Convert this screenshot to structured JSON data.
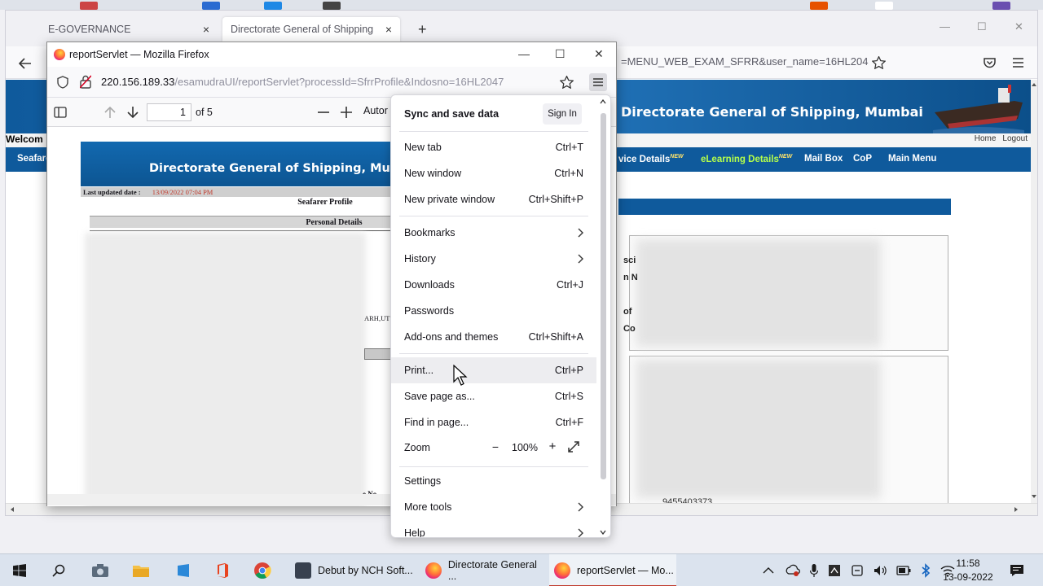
{
  "background_browser": {
    "tabs": [
      {
        "label": "E-GOVERNANCE",
        "close": "×"
      },
      {
        "label": "Directorate General of Shipping",
        "close": "×"
      }
    ],
    "new_tab": "+",
    "url_tail": "=MENU_WEB_EXAM_SFRR&user_name=16HL204",
    "header_title": "Directorate General of Shipping, Mumbai",
    "welcome": "Welcom",
    "home": "Home",
    "logout": "Logout",
    "menu": [
      {
        "label": "Seafare"
      },
      {
        "label": "vice Details",
        "new": "NEW"
      },
      {
        "label": "eLearning Details",
        "new": "NEW"
      },
      {
        "label": "Mail Box"
      },
      {
        "label": "CoP"
      },
      {
        "label": "Main Menu"
      }
    ],
    "partials": [
      "sci",
      "n N",
      "of",
      "Co"
    ],
    "phone": "9455403373"
  },
  "popup": {
    "title": "reportServlet — Mozilla Firefox",
    "url_host": "220.156.189.33",
    "url_path": "/esamudraUI/reportServlet?processId=SfrrProfile&Indosno=16HL2047",
    "pdf": {
      "page_number": "1",
      "page_of": "of 5",
      "zoom_select": "Autor",
      "banner_title": "Directorate General of Shipping, Mumbai",
      "last_updated_label": "Last updated date :",
      "last_updated_value": "13/09/2022 07:04 PM",
      "seafarer_profile": "Seafarer Profile",
      "personal_details": "Personal Details",
      "partial_text_1": "ARH,UT",
      "partial_text_2": "e No."
    }
  },
  "app_menu": {
    "sync_label": "Sync and save data",
    "sign_in": "Sign In",
    "items": [
      {
        "label": "New tab",
        "shortcut": "Ctrl+T"
      },
      {
        "label": "New window",
        "shortcut": "Ctrl+N"
      },
      {
        "label": "New private window",
        "shortcut": "Ctrl+Shift+P"
      },
      {
        "label": "Bookmarks",
        "shortcut": ""
      },
      {
        "label": "History",
        "shortcut": ""
      },
      {
        "label": "Downloads",
        "shortcut": "Ctrl+J"
      },
      {
        "label": "Passwords",
        "shortcut": ""
      },
      {
        "label": "Add-ons and themes",
        "shortcut": "Ctrl+Shift+A"
      },
      {
        "label": "Print...",
        "shortcut": "Ctrl+P"
      },
      {
        "label": "Save page as...",
        "shortcut": "Ctrl+S"
      },
      {
        "label": "Find in page...",
        "shortcut": "Ctrl+F"
      },
      {
        "label": "Settings",
        "shortcut": ""
      },
      {
        "label": "More tools",
        "shortcut": ""
      },
      {
        "label": "Help",
        "shortcut": ""
      }
    ],
    "zoom_label": "Zoom",
    "zoom_minus": "−",
    "zoom_value": "100%",
    "zoom_plus": "+"
  },
  "taskbar": {
    "apps": [
      {
        "label": "Debut by NCH Soft..."
      },
      {
        "label": "Directorate General ..."
      },
      {
        "label": "reportServlet — Mo..."
      }
    ],
    "time": "11:58",
    "date": "13-09-2022"
  },
  "colors": {
    "dgs_blue": "#0f5a9c",
    "menu_hover": "#ededf0",
    "taskbar": "#dbe3ee",
    "active_underline": "#c0392b"
  }
}
